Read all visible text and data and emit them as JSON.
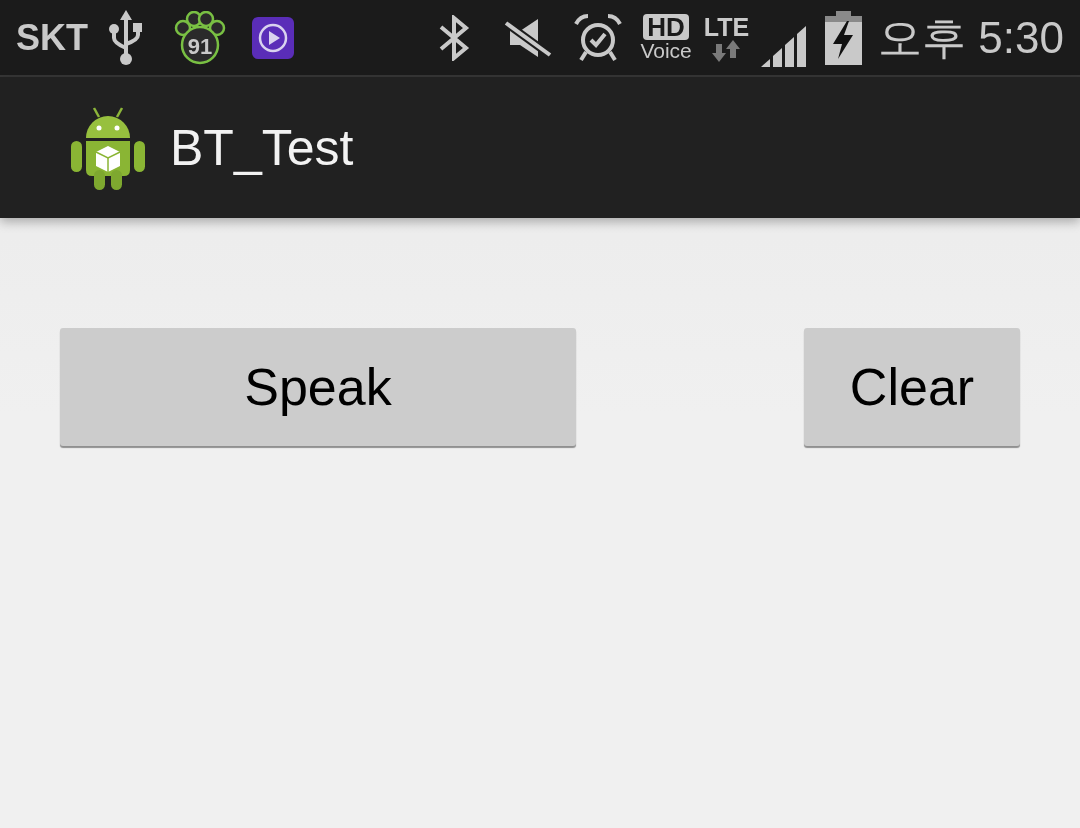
{
  "status_bar": {
    "carrier": "SKT",
    "notification_count": "91",
    "hd_voice": {
      "hd": "HD",
      "voice": "Voice"
    },
    "network": "LTE",
    "time": "오후 5:30"
  },
  "action_bar": {
    "title": "BT_Test"
  },
  "buttons": [
    {
      "label": "Speak"
    },
    {
      "label": "Clear"
    }
  ]
}
